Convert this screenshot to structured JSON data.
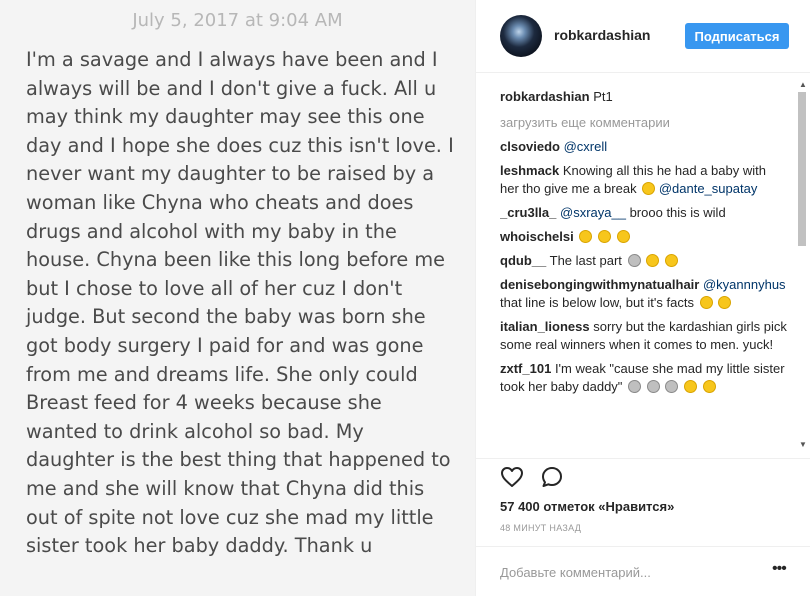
{
  "note": {
    "date": "July 5, 2017 at 9:04 AM",
    "text": "I'm a savage and I always have been and I always will be and I don't give a fuck. All u may think my daughter may see this one day and I hope she does cuz this isn't love. I never want my daughter to be raised by a woman like Chyna who cheats and does drugs and alcohol with my baby in the house. Chyna been like this long before me but I chose to love all of her cuz I don't judge. But second the baby was born she got body surgery I paid for and was gone from me and dreams life. She only could Breast feed for 4 weeks because she wanted to drink alcohol so bad. My daughter is the best thing that happened to me and she will know that Chyna did this out of spite not love cuz she mad my little sister took her baby daddy. Thank u"
  },
  "header": {
    "username": "robkardashian",
    "follow_label": "Подписаться"
  },
  "caption": {
    "username": "robkardashian",
    "text": "Pt1"
  },
  "load_more": "загрузить еще комментарии",
  "comments": [
    {
      "username": "clsoviedo",
      "text": "",
      "mention": "@cxrell"
    },
    {
      "username": "leshmack",
      "text": "Knowing all this he had a baby with her tho give me a break",
      "mention": "@dante_supatay"
    },
    {
      "username": "_cru3lla_",
      "text": "",
      "mention": "@sxraya__",
      "text_after": "brooo this is wild"
    },
    {
      "username": "whoischelsi",
      "text": ""
    },
    {
      "username": "qdub__",
      "text": "The last part"
    },
    {
      "username": "denisebongingwithmynatualhair",
      "text": "",
      "mention": "@kyannnyhus",
      "text_after": "that line is below low, but it's facts"
    },
    {
      "username": "italian_lioness",
      "text": "sorry but the kardashian girls pick some real winners when it comes to men. yuck!"
    },
    {
      "username": "zxtf_101",
      "text": "I'm weak \"cause she mad my little sister took her baby daddy\""
    }
  ],
  "icons": {
    "like": "heart-icon",
    "comment": "comment-bubble-icon",
    "more": "more-options-icon"
  },
  "likes_text": "57 400 отметок «Нравится»",
  "timestamp": "48 МИНУТ НАЗАД",
  "add_comment": {
    "placeholder": "Добавьте комментарий...",
    "more_label": "•••"
  },
  "colors": {
    "follow_button": "#3897f0",
    "link": "#003569",
    "note_bg": "#f4f4f4"
  }
}
